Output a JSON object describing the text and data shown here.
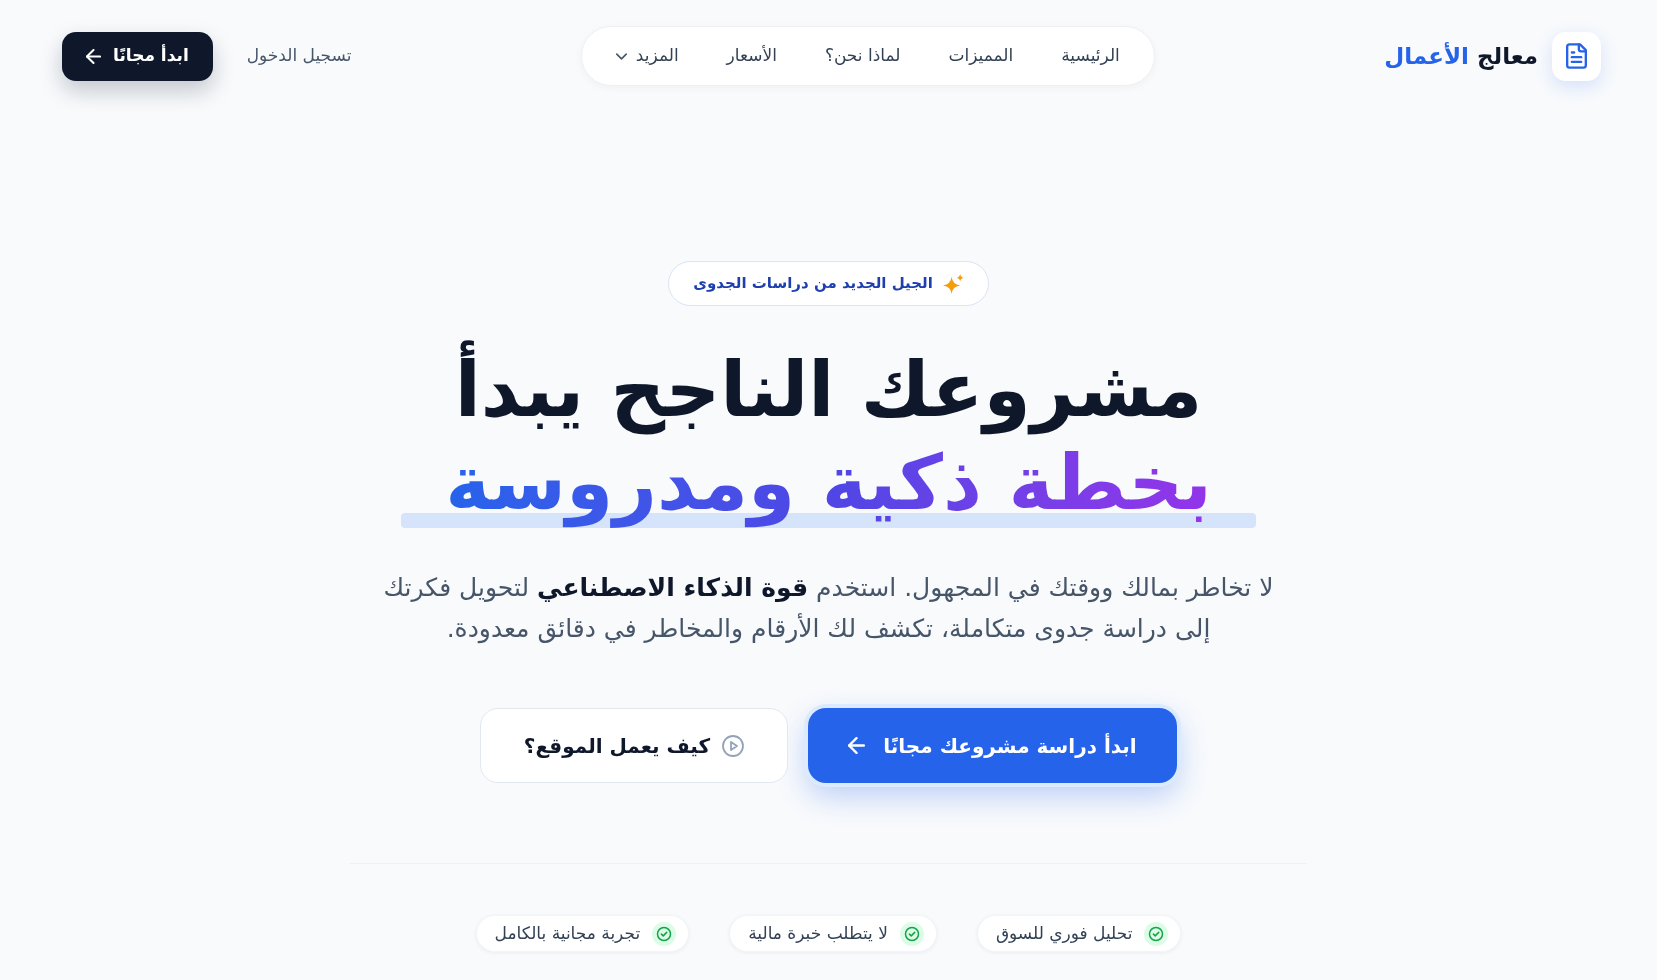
{
  "brand": {
    "name": "معالج",
    "accent": "الأعمال"
  },
  "nav": [
    {
      "label": "الرئيسية",
      "kind": "link"
    },
    {
      "label": "المميزات",
      "kind": "link"
    },
    {
      "label": "لماذا نحن؟",
      "kind": "link"
    },
    {
      "label": "الأسعار",
      "kind": "link"
    },
    {
      "label": "المزيد",
      "kind": "dropdown"
    }
  ],
  "header_actions": {
    "login": "تسجيل الدخول",
    "cta": "ابدأ مجانًا"
  },
  "hero": {
    "badge": "الجيل الجديد من دراسات الجدوى",
    "headline": "مشروعك الناجح يبدأ",
    "headline_accent": "بخطة ذكية ومدروسة",
    "description": "لا تخاطر بمالك ووقتك في المجهول. استخدم **قوة الذكاء الاصطناعي** لتحويل فكرتك إلى دراسة جدوى متكاملة، تكشف لك الأرقام والمخاطر في دقائق معدودة.",
    "primary_button": "ابدأ دراسة مشروعك مجانًا",
    "secondary_button": "كيف يعمل الموقع؟"
  },
  "features": [
    {
      "label": "تحليل فوري للسوق"
    },
    {
      "label": "لا يتطلب خبرة مالية"
    },
    {
      "label": "تجربة مجانية بالكامل"
    }
  ]
}
